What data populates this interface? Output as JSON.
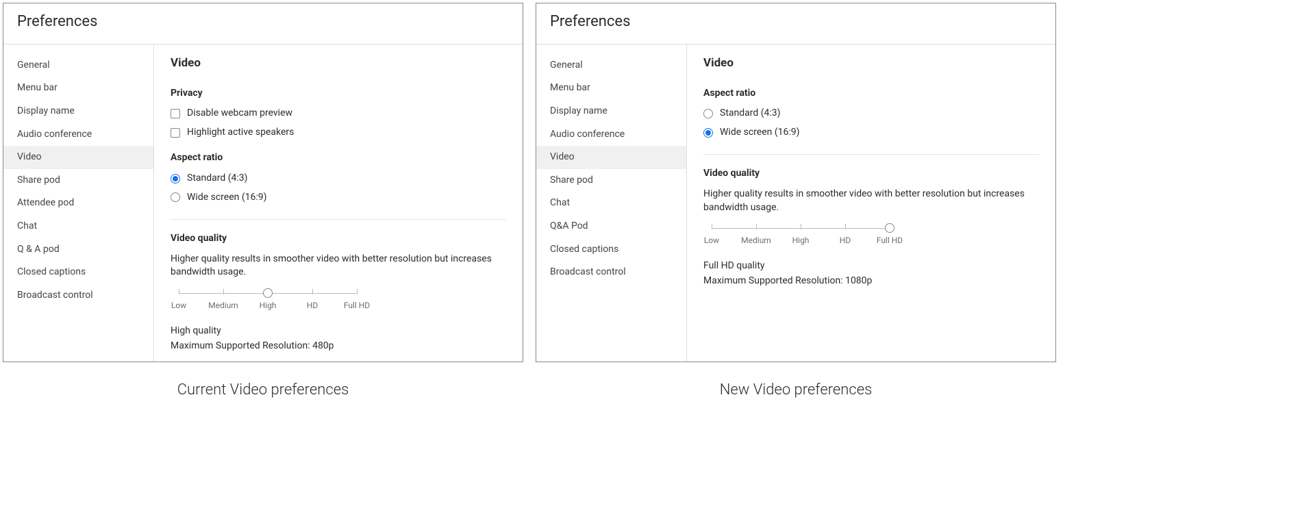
{
  "left": {
    "title": "Preferences",
    "caption": "Current Video preferences",
    "sidebar": {
      "items": [
        "General",
        "Menu bar",
        "Display name",
        "Audio conference",
        "Video",
        "Share pod",
        "Attendee pod",
        "Chat",
        "Q & A pod",
        "Closed captions",
        "Broadcast control"
      ],
      "active_index": 4
    },
    "content": {
      "heading": "Video",
      "privacy": {
        "title": "Privacy",
        "disable_preview": "Disable webcam preview",
        "highlight_speakers": "Highlight active speakers"
      },
      "aspect": {
        "title": "Aspect ratio",
        "opt_standard": "Standard (4:3)",
        "opt_wide": "Wide screen (16:9)",
        "selected": "standard"
      },
      "quality": {
        "title": "Video quality",
        "desc": "Higher quality results in smoother video with better resolution but increases bandwidth usage.",
        "labels": [
          "Low",
          "Medium",
          "High",
          "HD",
          "Full HD"
        ],
        "selected_index": 2,
        "summary_line1": "High quality",
        "summary_line2": "Maximum Supported Resolution: 480p"
      }
    }
  },
  "right": {
    "title": "Preferences",
    "caption": "New Video preferences",
    "sidebar": {
      "items": [
        "General",
        "Menu bar",
        "Display name",
        "Audio conference",
        "Video",
        "Share pod",
        "Chat",
        "Q&A Pod",
        "Closed captions",
        "Broadcast control"
      ],
      "active_index": 4
    },
    "content": {
      "heading": "Video",
      "aspect": {
        "title": "Aspect ratio",
        "opt_standard": "Standard (4:3)",
        "opt_wide": "Wide screen (16:9)",
        "selected": "wide"
      },
      "quality": {
        "title": "Video quality",
        "desc": "Higher quality results in smoother video with better resolution but increases bandwidth usage.",
        "labels": [
          "Low",
          "Medium",
          "High",
          "HD",
          "Full HD"
        ],
        "selected_index": 4,
        "summary_line1": "Full HD quality",
        "summary_line2": "Maximum Supported Resolution: 1080p"
      }
    }
  }
}
